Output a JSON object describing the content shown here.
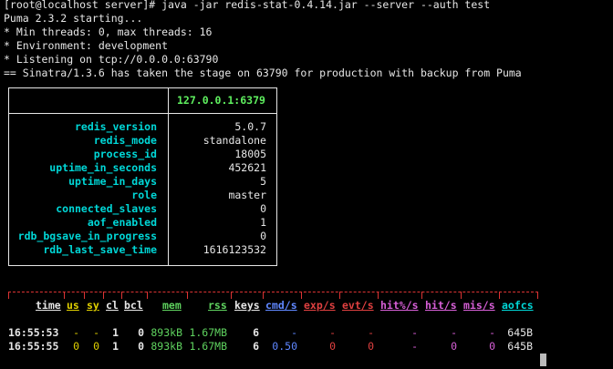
{
  "terminal": {
    "lines": [
      "[root@localhost server]# java -jar redis-stat-0.4.14.jar --server --auth test",
      "Puma 2.3.2 starting...",
      "* Min threads: 0, max threads: 16",
      "* Environment: development",
      "* Listening on tcp://0.0.0.0:63790",
      "== Sinatra/1.3.6 has taken the stage on 63790 for production with backup from Puma"
    ]
  },
  "info": {
    "host": "127.0.0.1:6379",
    "rows": [
      {
        "key": "redis_version",
        "value": "5.0.7"
      },
      {
        "key": "redis_mode",
        "value": "standalone"
      },
      {
        "key": "process_id",
        "value": "18005"
      },
      {
        "key": "uptime_in_seconds",
        "value": "452621"
      },
      {
        "key": "uptime_in_days",
        "value": "5"
      },
      {
        "key": "role",
        "value": "master"
      },
      {
        "key": "connected_slaves",
        "value": "0"
      },
      {
        "key": "aof_enabled",
        "value": "1"
      },
      {
        "key": "rdb_bgsave_in_progress",
        "value": "0"
      },
      {
        "key": "rdb_last_save_time",
        "value": "1616123532"
      }
    ]
  },
  "stats": {
    "headers": [
      "time",
      "us",
      "sy",
      "cl",
      "bcl",
      "mem",
      "rss",
      "keys",
      "cmd/s",
      "exp/s",
      "evt/s",
      "hit%/s",
      "hit/s",
      "mis/s",
      "aofcs"
    ],
    "colors": {
      "white": "#e6e6e6",
      "yellow": "#e0d000",
      "green": "#5fd35f",
      "cyan": "#00d7d7",
      "blue": "#5f87ff",
      "red": "#e04040",
      "magenta": "#d75fd7",
      "rule": "#d33"
    },
    "rows": [
      [
        "16:55:53",
        "-",
        "-",
        "1",
        "0",
        "893kB",
        "1.67MB",
        "6",
        "-",
        "-",
        "-",
        "-",
        "-",
        "-",
        "645B"
      ],
      [
        "16:55:55",
        "0",
        "0",
        "1",
        "0",
        "893kB",
        "1.67MB",
        "6",
        "0.50",
        "0",
        "0",
        "-",
        "0",
        "0",
        "645B"
      ]
    ]
  }
}
